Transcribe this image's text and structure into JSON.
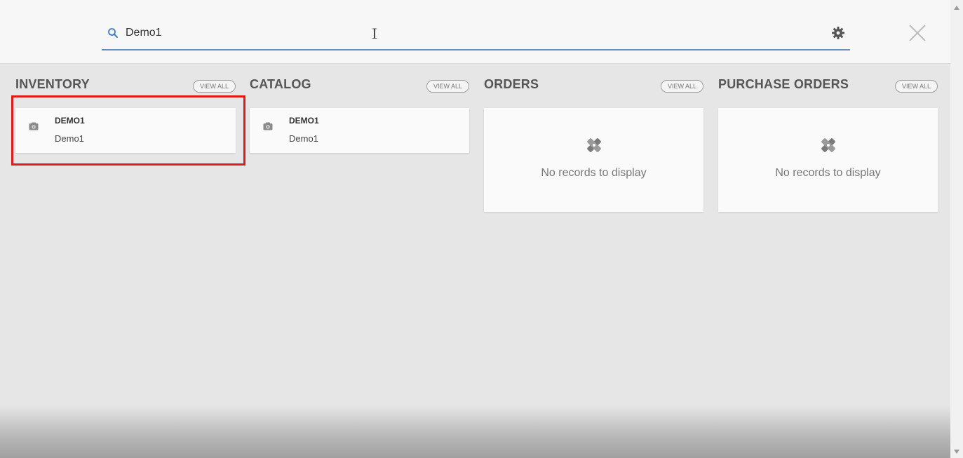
{
  "search": {
    "value": "Demo1",
    "cursor_glyph": "I"
  },
  "icons": {
    "search": "search-icon",
    "settings": "gear-icon",
    "close": "close-icon",
    "record": "camera-icon",
    "empty": "broken-image-icon"
  },
  "colors": {
    "highlight": "#e01b1b",
    "search_underline": "#6e8fb0",
    "search_icon": "#3d7ad6"
  },
  "sections": [
    {
      "title": "INVENTORY",
      "view_all": "VIEW ALL",
      "records": [
        {
          "code": "DEMO1",
          "name": "Demo1"
        }
      ]
    },
    {
      "title": "CATALOG",
      "view_all": "VIEW ALL",
      "records": [
        {
          "code": "DEMO1",
          "name": "Demo1"
        }
      ]
    },
    {
      "title": "ORDERS",
      "view_all": "VIEW ALL",
      "empty_text": "No records to display"
    },
    {
      "title": "PURCHASE ORDERS",
      "view_all": "VIEW ALL",
      "empty_text": "No records to display"
    }
  ]
}
